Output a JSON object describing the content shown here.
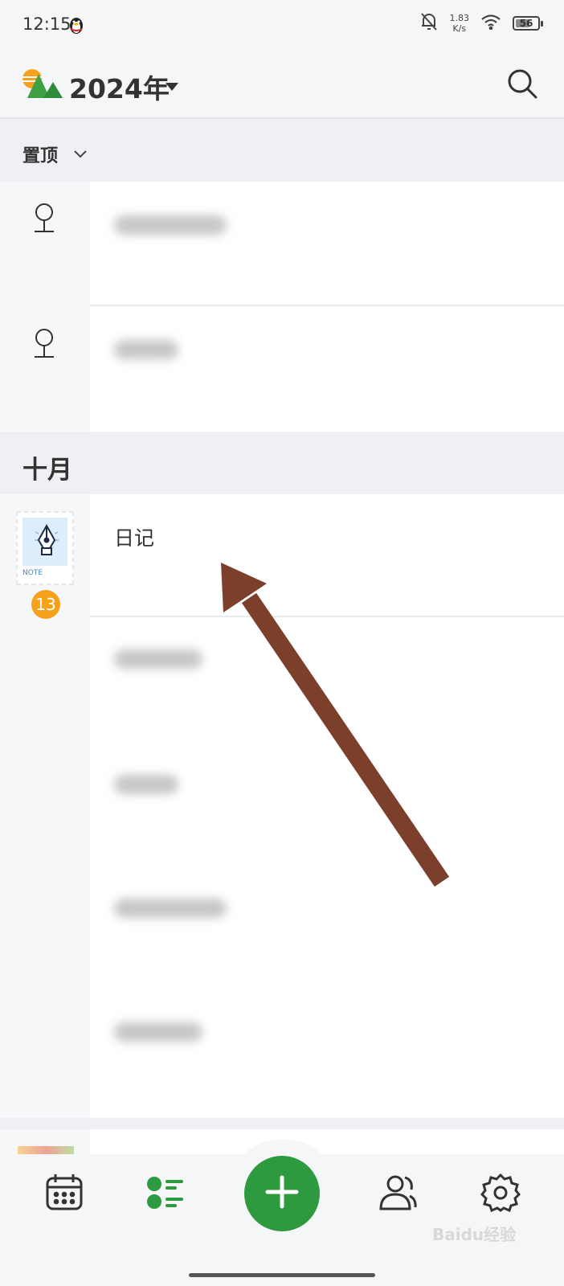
{
  "status_bar": {
    "time": "12:15",
    "net_speed_value": "1.83",
    "net_speed_unit": "K/s",
    "battery": "56"
  },
  "header": {
    "year_title": "2024年",
    "icons": [
      "app-logo-icon",
      "dropdown-caret-icon",
      "search-icon"
    ]
  },
  "pinned": {
    "label": "置顶",
    "items": [
      {
        "icon": "pin-icon"
      },
      {
        "icon": "pin-icon"
      }
    ]
  },
  "month_section": {
    "label": "十月",
    "note": {
      "title": "日记",
      "stamp_text": "NOTE",
      "badge_count": "13"
    }
  },
  "bottom_nav": {
    "items": [
      "calendar-icon",
      "list-icon",
      "add-icon",
      "contacts-icon",
      "settings-icon"
    ],
    "active": "list-icon"
  },
  "colors": {
    "accent_green": "#2e9a3f",
    "badge_orange": "#f5a11a",
    "arrow_brown": "#7b3f2b"
  },
  "watermark": "Baidu经验"
}
